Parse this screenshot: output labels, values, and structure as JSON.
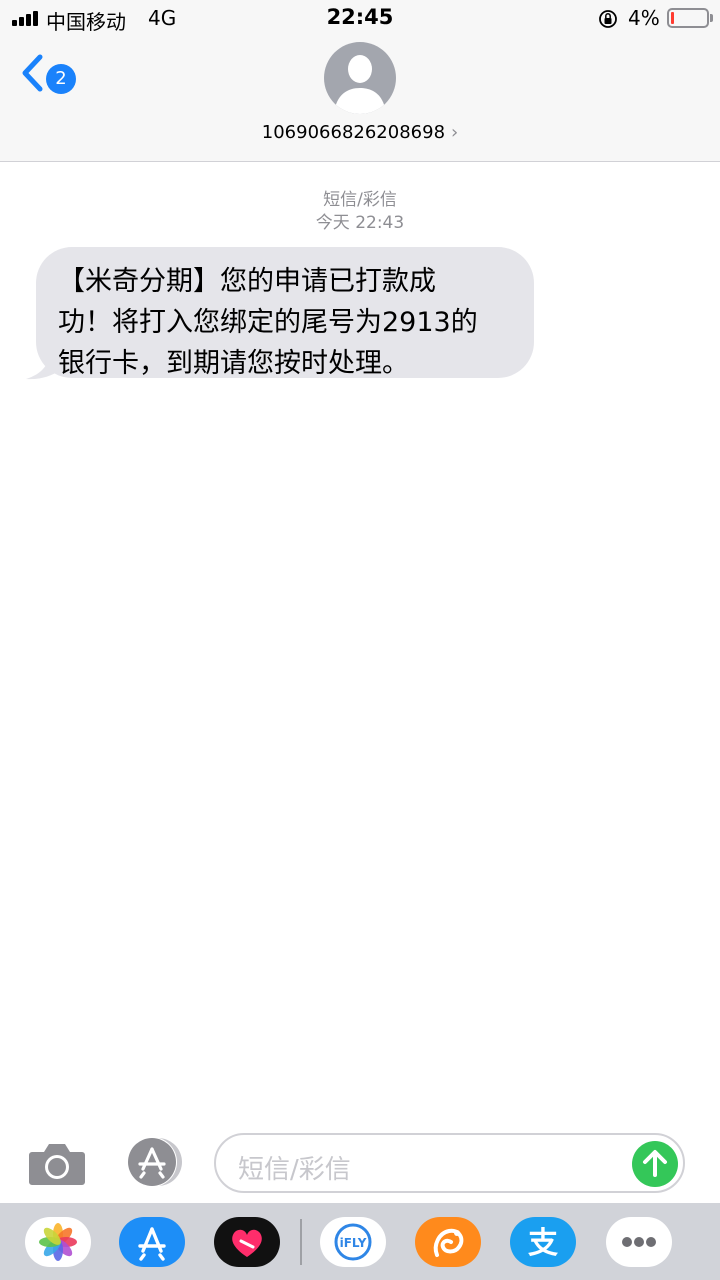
{
  "status_bar": {
    "carrier": "中国移动",
    "network": "4G",
    "time": "22:45",
    "battery_percent": "4%",
    "battery_level": 0.04,
    "icons": [
      "signal-icon",
      "orientation-lock-icon",
      "battery-icon"
    ]
  },
  "header": {
    "back_badge": "2",
    "contact_number": "1069066826208698",
    "chevron": "›"
  },
  "conversation": {
    "message_type": "短信/彩信",
    "timestamp": "今天 22:43",
    "messages": [
      {
        "direction": "incoming",
        "lines": [
          "【米奇分期】您的申请已打款成",
          "功！将打入您绑定的尾号为2913的",
          "银行卡，到期请您按时处理。"
        ]
      }
    ]
  },
  "input_bar": {
    "placeholder": "短信/彩信",
    "icons": [
      "camera-icon",
      "app-store-icon",
      "send-arrow-icon"
    ]
  },
  "app_drawer": {
    "apps": [
      "photos-icon",
      "app-store-icon",
      "digital-touch-icon",
      "ifly-icon",
      "uc-browser-icon",
      "alipay-icon",
      "more-icon"
    ],
    "ifly_label": "iFLY",
    "alipay_glyph": "支"
  },
  "colors": {
    "ios_blue": "#1a82fb",
    "bubble_gray": "#e5e5ea",
    "send_green": "#34c759",
    "battery_red": "#ff3b30"
  }
}
